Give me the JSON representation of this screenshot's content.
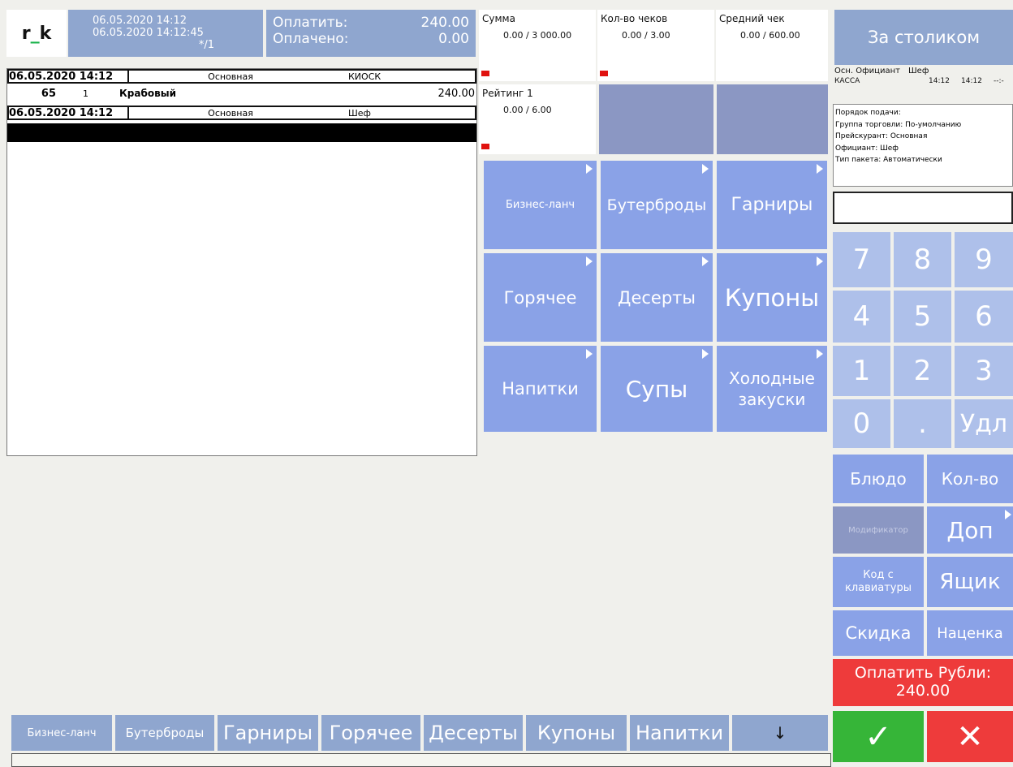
{
  "header": {
    "logo_left": "r",
    "logo_mid": "_",
    "logo_right": "k",
    "date_line1": "06.05.2020 14:12",
    "date_line2": "06.05.2020 14:12:45",
    "date_line3": "*/1",
    "pay_label": "Оплатить:",
    "pay_value": "240.00",
    "paid_label": "Оплачено:",
    "paid_value": "0.00"
  },
  "order": {
    "rows": [
      {
        "date": "06.05.2020 14:12",
        "price_list": "Основная",
        "place": "КИОСК"
      },
      {
        "code": "65",
        "qty": "1",
        "name": "Крабовый",
        "amount": "240.00"
      },
      {
        "date": "06.05.2020 14:12",
        "price_list": "Основная",
        "waiter": "Шеф"
      }
    ]
  },
  "stats": [
    {
      "label": "Сумма",
      "value": "0.00 / 3 000.00"
    },
    {
      "label": "Кол-во чеков",
      "value": "0.00 / 3.00"
    },
    {
      "label": "Средний чек",
      "value": "0.00 / 600.00"
    },
    {
      "label": "Рейтинг 1",
      "value": "0.00 / 6.00"
    }
  ],
  "categories": [
    "Бизнес-ланч",
    "Бутерброды",
    "Гарниры",
    "Горячее",
    "Десерты",
    "Купоны",
    "Напитки",
    "Супы",
    "Холодные закуски"
  ],
  "right": {
    "table_button": "За столиком",
    "waiter_role": "Осн. Официант",
    "waiter_name": "Шеф",
    "register": "КАССА",
    "time1": "14:12",
    "time2": "14:12",
    "time3": "--:-",
    "info_lines": [
      "Порядок подачи:",
      "Группа торговли: По-умолчанию",
      "Прейскурант: Основная",
      "Официант: Шеф",
      "Тип пакета: Автоматически"
    ],
    "numpad": [
      "7",
      "8",
      "9",
      "4",
      "5",
      "6",
      "1",
      "2",
      "3",
      "0",
      ".",
      "Удл"
    ],
    "actions": {
      "dish": "Блюдо",
      "qty": "Кол-во",
      "modifier": "Модификатор",
      "extra": "Доп",
      "keyboard_code": "Код с клавиатуры",
      "drawer": "Ящик",
      "discount": "Скидка",
      "markup": "Наценка"
    },
    "pay_line1": "Оплатить Рубли:",
    "pay_line2": "240.00",
    "ok_icon": "✓",
    "cancel_icon": "✕"
  },
  "bottom_strip": [
    "Бизнес-ланч",
    "Бутерброды",
    "Гарниры",
    "Горячее",
    "Десерты",
    "Купоны",
    "Напитки",
    "↓"
  ],
  "colors": {
    "tile_blue": "#8aa2e7",
    "header_blue": "#8fa6cf",
    "numpad_blue": "#aec0ea",
    "pay_red": "#ee3b3b",
    "ok_green": "#36b538"
  }
}
